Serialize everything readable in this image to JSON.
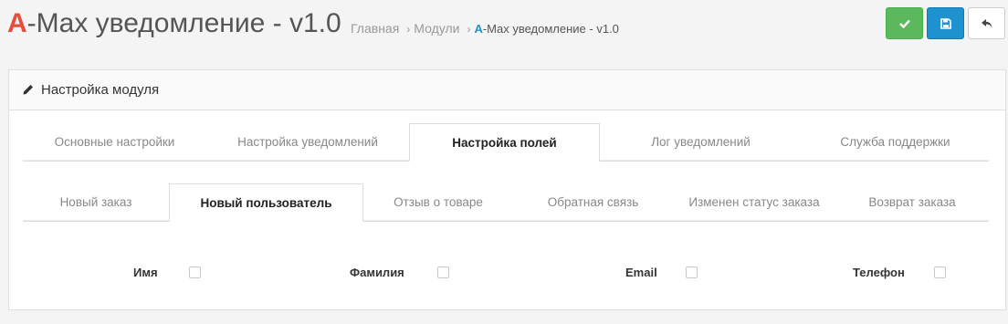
{
  "header": {
    "title_initial": "A",
    "title_rest": "-Max уведомление - v1.0",
    "breadcrumb": [
      {
        "label": "Главная"
      },
      {
        "label": "Модули"
      }
    ],
    "breadcrumb_current_initial": "A",
    "breadcrumb_current_rest": "-Max уведомление - v1.0",
    "separator": "›"
  },
  "toolbar": {
    "save_icon": "check-icon",
    "save_stay_icon": "floppy-disk-icon",
    "back_icon": "reply-arrow-icon",
    "colors": {
      "save": "#5cb85c",
      "save_stay": "#1e91cf",
      "back": "#ffffff"
    }
  },
  "panel": {
    "heading": "Настройка модуля",
    "heading_icon": "pencil-icon"
  },
  "main_tabs": [
    {
      "label": "Основные настройки",
      "active": false
    },
    {
      "label": "Настройка уведомлений",
      "active": false
    },
    {
      "label": "Настройка полей",
      "active": true
    },
    {
      "label": "Лог уведомлений",
      "active": false
    },
    {
      "label": "Служба поддержки",
      "active": false
    }
  ],
  "sub_tabs": [
    {
      "label": "Новый заказ",
      "active": false
    },
    {
      "label": "Новый пользователь",
      "active": true
    },
    {
      "label": "Отзыв о товаре",
      "active": false
    },
    {
      "label": "Обратная связь",
      "active": false
    },
    {
      "label": "Изменен статус заказа",
      "active": false
    },
    {
      "label": "Возврат заказа",
      "active": false
    }
  ],
  "fields": [
    {
      "label": "Имя",
      "checked": false
    },
    {
      "label": "Фамилия",
      "checked": false
    },
    {
      "label": "Email",
      "checked": false
    },
    {
      "label": "Телефон",
      "checked": false
    }
  ],
  "colors": {
    "accent_red": "#e74c3c",
    "accent_blue": "#1e91cf"
  }
}
